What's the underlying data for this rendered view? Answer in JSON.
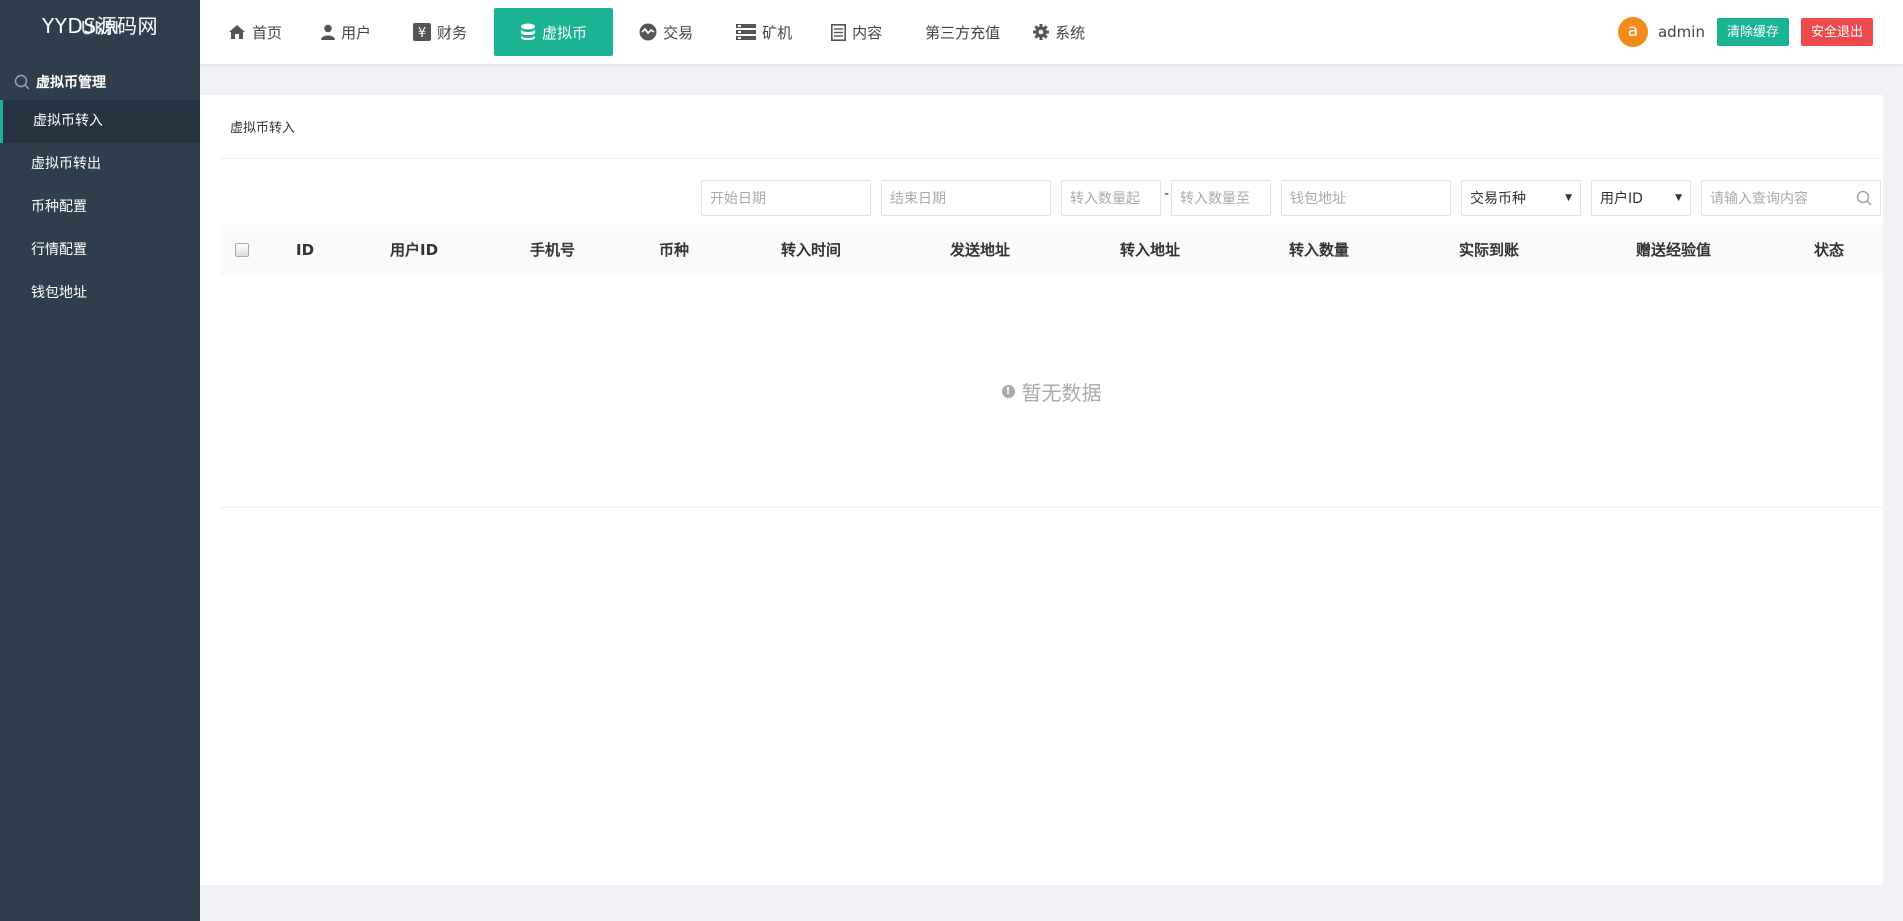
{
  "logo": {
    "line1": "YYDS源码网",
    "line2": "UKN"
  },
  "sidebar": {
    "title": "虚拟币管理",
    "items": [
      {
        "label": "虚拟币转入",
        "active": true
      },
      {
        "label": "虚拟币转出"
      },
      {
        "label": "币种配置"
      },
      {
        "label": "行情配置"
      },
      {
        "label": "钱包地址"
      }
    ]
  },
  "nav": {
    "items": [
      {
        "label": "首页",
        "icon": "home-icon"
      },
      {
        "label": "用户",
        "icon": "user-icon"
      },
      {
        "label": "财务",
        "icon": "yen-icon"
      },
      {
        "label": "虚拟币",
        "icon": "database-icon",
        "active": true
      },
      {
        "label": "交易",
        "icon": "exchange-icon"
      },
      {
        "label": "矿机",
        "icon": "server-icon"
      },
      {
        "label": "内容",
        "icon": "document-icon"
      },
      {
        "label": "第三方充值"
      },
      {
        "label": "系统",
        "icon": "gear-icon"
      }
    ]
  },
  "user": {
    "avatar_letter": "a",
    "name": "admin",
    "clear_cache": "清除缓存",
    "logout": "安全退出"
  },
  "page": {
    "title": "虚拟币转入"
  },
  "filters": {
    "start_date": "开始日期",
    "end_date": "结束日期",
    "amount_from": "转入数量起",
    "dash": "-",
    "amount_to": "转入数量至",
    "wallet": "钱包地址",
    "coin_select": "交易币种",
    "field_select": "用户ID",
    "query": "请输入查询内容"
  },
  "table": {
    "columns": [
      "ID",
      "用户ID",
      "手机号",
      "币种",
      "转入时间",
      "发送地址",
      "转入地址",
      "转入数量",
      "实际到账",
      "赠送经验值",
      "状态"
    ],
    "empty": "暂无数据"
  },
  "colors": {
    "accent": "#1ab394",
    "danger": "#ed4a4d",
    "sidebar": "#2f3e4d",
    "avatar": "#f38b1c"
  }
}
